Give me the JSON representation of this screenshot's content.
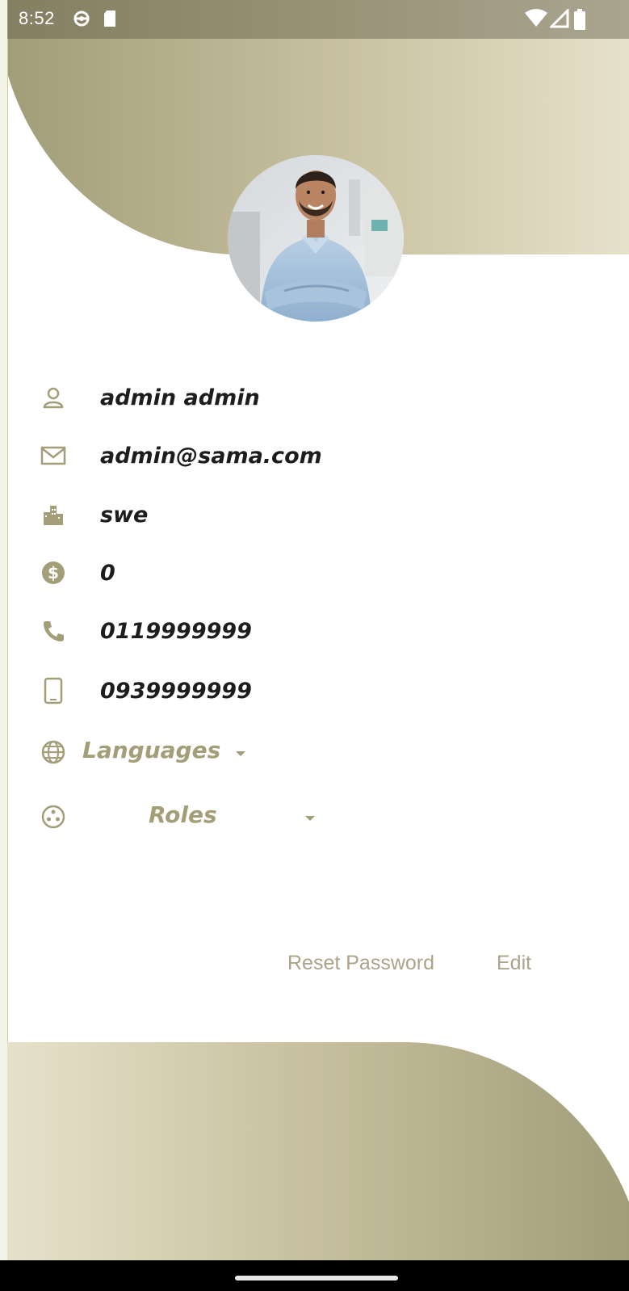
{
  "status_bar": {
    "time": "8:52",
    "icons": [
      "settings-gear-icon",
      "sd-card-icon",
      "wifi-icon",
      "signal-icon",
      "battery-icon"
    ]
  },
  "profile": {
    "avatar_icon": "profile-photo",
    "name": "admin admin",
    "email": "admin@sama.com",
    "company": "swe",
    "balance": "0",
    "phone": "0119999999",
    "mobile": "0939999999",
    "languages_label": "Languages",
    "roles_label": "Roles"
  },
  "actions": {
    "reset_password": "Reset Password",
    "edit": "Edit"
  },
  "colors": {
    "accent": "#a39d78",
    "wave_dark": "#a29d79",
    "wave_light": "#e9e5cf",
    "text": "#1d1d1d",
    "button_text": "#a9a48a"
  }
}
